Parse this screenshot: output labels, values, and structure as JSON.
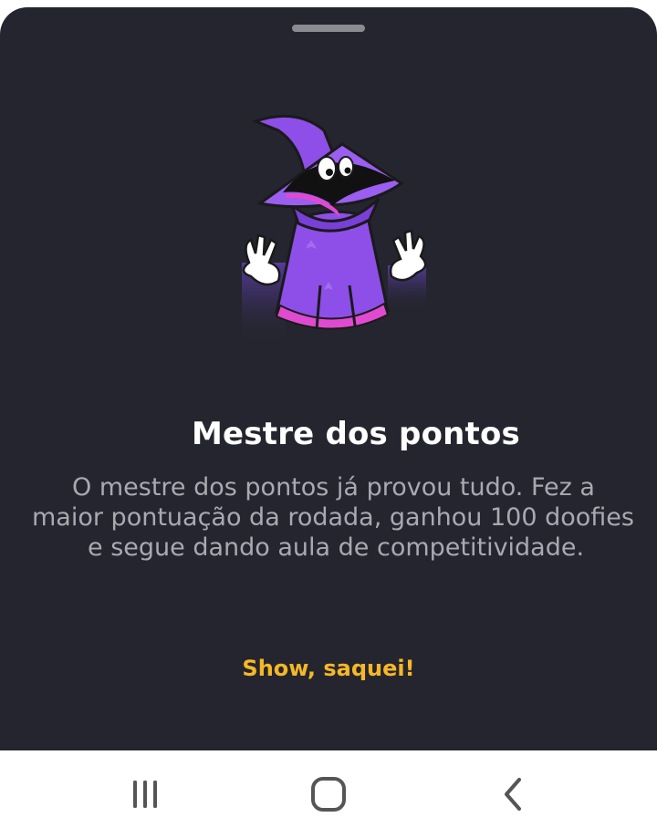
{
  "dialog": {
    "title": "Mestre dos pontos",
    "description_lines": [
      "O mestre dos pontos já provou tudo. Fez a",
      "maior pontuação da rodada, ganhou 100 doofies",
      "e segue dando aula de competitividade."
    ],
    "confirm_label": "Show, saquei!",
    "illustration": "wizard-character",
    "accent_color": "#f5b826",
    "background_color": "#25252f"
  },
  "navigation_bar": {
    "buttons": [
      {
        "name": "recent-apps",
        "icon": "recent-apps-icon"
      },
      {
        "name": "home",
        "icon": "home-icon"
      },
      {
        "name": "back",
        "icon": "back-icon"
      }
    ]
  }
}
